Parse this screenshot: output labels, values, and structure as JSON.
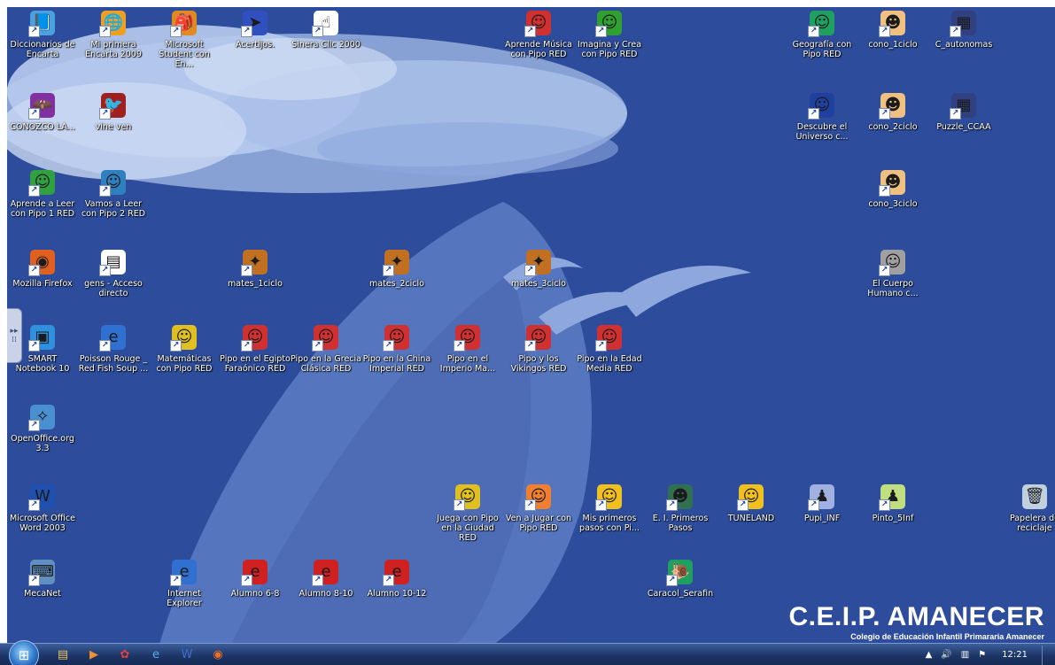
{
  "desktop": {
    "icons": [
      {
        "id": "diccionarios",
        "label": "Diccionarios de Encarta",
        "icon": "book-icon",
        "color": "#4aa0e0",
        "x": 0,
        "y": 0
      },
      {
        "id": "mi-primera-encarta",
        "label": "Mi primera Encarta 2009",
        "icon": "globe-icon",
        "color": "#f0a020",
        "x": 1,
        "y": 0
      },
      {
        "id": "microsoft-student",
        "label": "Microsoft Student con En...",
        "icon": "backpack-icon",
        "color": "#e08a20",
        "x": 2,
        "y": 0
      },
      {
        "id": "acertijos",
        "label": "Acertijos.",
        "icon": "arrow-icon",
        "color": "#3050c0",
        "x": 3,
        "y": 0
      },
      {
        "id": "sinera-clic",
        "label": "Sinera Clic 2000",
        "icon": "hand-pointer-icon",
        "color": "#ffffff",
        "x": 4,
        "y": 0
      },
      {
        "id": "aprende-musica",
        "label": "Aprende Música con Pipo RED",
        "icon": "pipo-face-icon",
        "color": "#d03030",
        "x": 7,
        "y": 0
      },
      {
        "id": "imagina-crea",
        "label": "Imagina y Crea con Pipo RED",
        "icon": "pipo-face-icon",
        "color": "#30a030",
        "x": 8,
        "y": 0
      },
      {
        "id": "geografia",
        "label": "Geografía con Pipo RED",
        "icon": "pipo-face-icon",
        "color": "#20a060",
        "x": 11,
        "y": 0
      },
      {
        "id": "cono-1ciclo",
        "label": "cono_1ciclo",
        "icon": "clown-icon",
        "color": "#f0c080",
        "x": 12,
        "y": 0
      },
      {
        "id": "c-autonomas",
        "label": "C_autonomas",
        "icon": "map-icon",
        "color": "#304080",
        "x": 13,
        "y": 0
      },
      {
        "id": "conozco",
        "label": "CONOZCO LA...",
        "icon": "bat-icon",
        "color": "#8030a0",
        "x": 0,
        "y": 1
      },
      {
        "id": "vine-ven",
        "label": "vine ven",
        "icon": "bird-icon",
        "color": "#a02020",
        "x": 1,
        "y": 1
      },
      {
        "id": "descubre-universo",
        "label": "Descubre el Universo c...",
        "icon": "pipo-face-icon",
        "color": "#2040a0",
        "x": 11,
        "y": 1
      },
      {
        "id": "cono-2ciclo",
        "label": "cono_2ciclo",
        "icon": "clown-icon",
        "color": "#f0c080",
        "x": 12,
        "y": 1
      },
      {
        "id": "puzzle-ccaa",
        "label": "Puzzle_CCAA",
        "icon": "map-icon",
        "color": "#304080",
        "x": 13,
        "y": 1
      },
      {
        "id": "aprende-leer-1",
        "label": "Aprende a Leer con Pipo 1 RED",
        "icon": "pipo-book-icon",
        "color": "#30a040",
        "x": 0,
        "y": 2
      },
      {
        "id": "vamos-leer-2",
        "label": "Vamos a Leer con Pipo 2 RED",
        "icon": "pipo-book-icon",
        "color": "#3080c0",
        "x": 1,
        "y": 2
      },
      {
        "id": "cono-3ciclo",
        "label": "cono_3ciclo",
        "icon": "clown-icon",
        "color": "#f0c080",
        "x": 12,
        "y": 2
      },
      {
        "id": "firefox",
        "label": "Mozilla Firefox",
        "icon": "firefox-icon",
        "color": "#e06020",
        "x": 0,
        "y": 3
      },
      {
        "id": "gens",
        "label": "gens - Acceso directo",
        "icon": "document-icon",
        "color": "#ffffff",
        "x": 1,
        "y": 3
      },
      {
        "id": "mates-1ciclo",
        "label": "mates_1ciclo",
        "icon": "mascot-icon",
        "color": "#c07020",
        "x": 3,
        "y": 3
      },
      {
        "id": "mates-2ciclo",
        "label": "mates_2ciclo",
        "icon": "mascot-icon",
        "color": "#c07020",
        "x": 5,
        "y": 3
      },
      {
        "id": "mates-3ciclo",
        "label": "mates_3ciclo",
        "icon": "mascot-icon",
        "color": "#c07020",
        "x": 7,
        "y": 3
      },
      {
        "id": "cuerpo-humano",
        "label": "El Cuerpo Humano c...",
        "icon": "pipo-face-icon",
        "color": "#a0a0a0",
        "x": 12,
        "y": 3
      },
      {
        "id": "smart-notebook",
        "label": "SMART Notebook 10",
        "icon": "notebook-icon",
        "color": "#3090e0",
        "x": 0,
        "y": 4
      },
      {
        "id": "poisson-rouge",
        "label": "Poisson Rouge _ Red Fish Soup ...",
        "icon": "ie-icon",
        "color": "#3070d0",
        "x": 1,
        "y": 4
      },
      {
        "id": "matematicas-pipo",
        "label": "Matemáticas con Pipo RED",
        "icon": "pipo-face-icon",
        "color": "#e0c020",
        "x": 2,
        "y": 4
      },
      {
        "id": "egipto",
        "label": "Pipo en el Egipto Faraónico RED",
        "icon": "pipo-face-icon",
        "color": "#d03030",
        "x": 3,
        "y": 4
      },
      {
        "id": "grecia",
        "label": "Pipo en la Grecia Clásica RED",
        "icon": "pipo-face-icon",
        "color": "#d03030",
        "x": 4,
        "y": 4
      },
      {
        "id": "china",
        "label": "Pipo en la China Imperial RED",
        "icon": "pipo-face-icon",
        "color": "#d03030",
        "x": 5,
        "y": 4
      },
      {
        "id": "imperio",
        "label": "Pipo en el Imperio Ma...",
        "icon": "pipo-face-icon",
        "color": "#d03030",
        "x": 6,
        "y": 4
      },
      {
        "id": "vikingos",
        "label": "Pipo y los Vikingos RED",
        "icon": "pipo-face-icon",
        "color": "#d03030",
        "x": 7,
        "y": 4
      },
      {
        "id": "edad-media",
        "label": "Pipo en la Edad Media RED",
        "icon": "pipo-face-icon",
        "color": "#d03030",
        "x": 8,
        "y": 4
      },
      {
        "id": "openoffice",
        "label": "OpenOffice.org 3.3",
        "icon": "openoffice-icon",
        "color": "#4a90d0",
        "x": 0,
        "y": 5
      },
      {
        "id": "word-2003",
        "label": "Microsoft Office Word 2003",
        "icon": "word-icon",
        "color": "#2050b0",
        "x": 0,
        "y": 6
      },
      {
        "id": "juega-ciudad",
        "label": "Juega con Pipo en la Ciudad RED",
        "icon": "pipo-face-icon",
        "color": "#e0c020",
        "x": 6,
        "y": 6
      },
      {
        "id": "ven-jugar",
        "label": "Ven a Jugar con Pipo RED",
        "icon": "pipo-face-icon",
        "color": "#f08030",
        "x": 7,
        "y": 6
      },
      {
        "id": "mis-primeros-pasos",
        "label": "Mis primeros pasos con Pi...",
        "icon": "pipo-face-icon",
        "color": "#f0c020",
        "x": 8,
        "y": 6
      },
      {
        "id": "primeros-pasos",
        "label": "E. I. Primeros Pasos",
        "icon": "kid-icon",
        "color": "#307050",
        "x": 9,
        "y": 6
      },
      {
        "id": "tuneland",
        "label": "TUNELAND",
        "icon": "cartoon-icon",
        "color": "#f0c020",
        "x": 10,
        "y": 6
      },
      {
        "id": "pupi-inf",
        "label": "Pupi_INF",
        "icon": "character-icon",
        "color": "#a0b0e0",
        "x": 11,
        "y": 6
      },
      {
        "id": "pinto-5inf",
        "label": "Pinto_5Inf",
        "icon": "character-icon",
        "color": "#c0e080",
        "x": 12,
        "y": 6
      },
      {
        "id": "papelera",
        "label": "Papelera de reciclaje",
        "icon": "recycle-bin-icon",
        "color": "#c0d0e0",
        "x": 14,
        "y": 6
      },
      {
        "id": "mecanet",
        "label": "MecaNet",
        "icon": "keyboard-icon",
        "color": "#6090c0",
        "x": 0,
        "y": 7
      },
      {
        "id": "internet-explorer",
        "label": "Internet Explorer",
        "icon": "ie-icon",
        "color": "#3070d0",
        "x": 2,
        "y": 7
      },
      {
        "id": "alumno-6-8",
        "label": "Alumno 6-8",
        "icon": "red-e-icon",
        "color": "#d02020",
        "x": 3,
        "y": 7
      },
      {
        "id": "alumno-8-10",
        "label": "Alumno 8-10",
        "icon": "red-e-icon",
        "color": "#d02020",
        "x": 4,
        "y": 7
      },
      {
        "id": "alumno-10-12",
        "label": "Alumno 10-12",
        "icon": "red-e-icon",
        "color": "#d02020",
        "x": 5,
        "y": 7
      },
      {
        "id": "caracol-serafin",
        "label": "Caracol_Serafin",
        "icon": "snail-icon",
        "color": "#20a060",
        "x": 9,
        "y": 7
      }
    ],
    "branding": {
      "title": "C.E.I.P. AMANECER",
      "subtitle": "Colegio de Educación Infantil Primararia Amanecer"
    }
  },
  "taskbar": {
    "pinned": [
      {
        "name": "explorer-icon",
        "glyph": "▤",
        "color": "#e8c060"
      },
      {
        "name": "media-player-icon",
        "glyph": "▶",
        "color": "#f09030"
      },
      {
        "name": "pipo-app-icon",
        "glyph": "✿",
        "color": "#e04040"
      },
      {
        "name": "ie-icon",
        "glyph": "e",
        "color": "#60a8f0"
      },
      {
        "name": "word-icon",
        "glyph": "W",
        "color": "#4070d0"
      },
      {
        "name": "firefox-icon",
        "glyph": "◉",
        "color": "#f07020"
      }
    ],
    "clock": "12:21"
  },
  "colors": {
    "desktop_bg": "#2f4f9f",
    "cloud": "#bcd0ee",
    "swirl": "#5d7cc4"
  }
}
